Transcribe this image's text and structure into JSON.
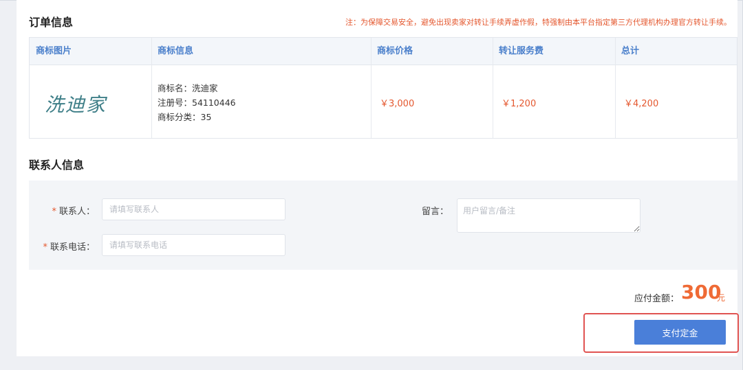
{
  "order": {
    "title": "订单信息",
    "notice": "注：为保障交易安全，避免出现卖家对转让手续弄虚作假，特强制由本平台指定第三方代理机构办理官方转让手续。",
    "columns": [
      "商标图片",
      "商标信息",
      "商标价格",
      "转让服务费",
      "总计"
    ],
    "row": {
      "logo_text": "洗迪家",
      "info": [
        "商标名：洗迪家",
        "注册号：54110446",
        "商标分类：35"
      ],
      "price": "￥3,000",
      "service_fee": "￥1,200",
      "total": "￥4,200"
    }
  },
  "contact": {
    "title": "联系人信息",
    "name_label": "联系人：",
    "name_placeholder": "请填写联系人",
    "phone_label": "联系电话：",
    "phone_placeholder": "请填写联系电话",
    "message_label": "留言：",
    "message_placeholder": "用户留言/备注",
    "required_mark": "*"
  },
  "payment": {
    "amount_label": "应付金额：",
    "amount": "300",
    "unit": "元",
    "pay_button": "支付定金"
  },
  "colors": {
    "accent": "#4a7fd9",
    "price": "#e4572e",
    "highlight": "#e05250"
  }
}
